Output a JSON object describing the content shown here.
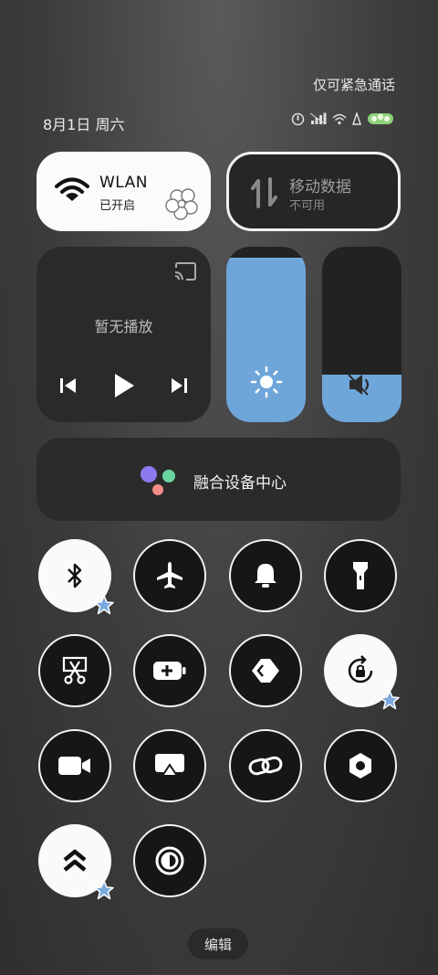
{
  "status_bar": {
    "emergency_text": "仅可紧急通话",
    "date_text": "8月1日 周六",
    "icons": [
      "do-not-disturb-icon",
      "signal-icon",
      "wifi-icon",
      "vpn-icon",
      "battery-icon"
    ]
  },
  "wlan_tile": {
    "title": "WLAN",
    "subtitle": "已开启",
    "icon": "wifi-icon"
  },
  "mobile_data_tile": {
    "title": "移动数据",
    "subtitle": "不可用",
    "icon": "data-arrows-icon"
  },
  "media_tile": {
    "empty_text": "暂无播放",
    "icons": [
      "cast-icon",
      "previous-icon",
      "play-icon",
      "next-icon"
    ]
  },
  "brightness_slider": {
    "level": 0.94,
    "icon": "sun-icon"
  },
  "volume_slider": {
    "level": 0.27,
    "icon": "speaker-mute-icon"
  },
  "fusion_center": {
    "label": "融合设备中心"
  },
  "quick_toggles": [
    {
      "name": "bluetooth",
      "on": true
    },
    {
      "name": "airplane",
      "on": false
    },
    {
      "name": "ring",
      "on": false
    },
    {
      "name": "flashlight",
      "on": false
    },
    {
      "name": "screenshot",
      "on": false
    },
    {
      "name": "battery-saver",
      "on": false
    },
    {
      "name": "nfc",
      "on": false
    },
    {
      "name": "rotation-lock",
      "on": true
    },
    {
      "name": "screen-record",
      "on": false
    },
    {
      "name": "screen-cast",
      "on": false
    },
    {
      "name": "link",
      "on": false
    },
    {
      "name": "settings",
      "on": false
    },
    {
      "name": "performance",
      "on": true
    },
    {
      "name": "dark-mode",
      "on": false
    }
  ],
  "edit_button": {
    "label": "编辑"
  },
  "colors": {
    "accent_blue": "#6fa6da",
    "badge_star": "#7aa9e0"
  }
}
